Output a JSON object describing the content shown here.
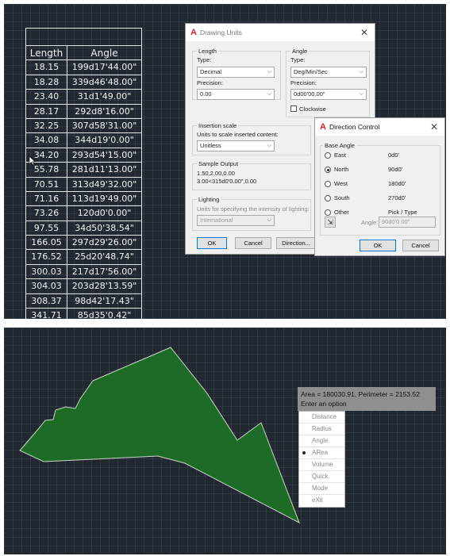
{
  "table": {
    "headers": [
      "Length",
      "Angle"
    ],
    "rows": [
      [
        "18.15",
        "199d17'44.00\""
      ],
      [
        "18.28",
        "339d46'48.00\""
      ],
      [
        "23.40",
        "31d1'49.00\""
      ],
      [
        "28.17",
        "292d8'16.00\""
      ],
      [
        "32.25",
        "307d58'31.00\""
      ],
      [
        "34.08",
        "344d19'0.00\""
      ],
      [
        "34.20",
        "293d54'15.00\""
      ],
      [
        "55.78",
        "281d11'13.00\""
      ],
      [
        "70.51",
        "313d49'32.00\""
      ],
      [
        "71.16",
        "113d19'49.00\""
      ],
      [
        "73.26",
        "120d0'0.00\""
      ],
      [
        "97.55",
        "34d50'38.54\""
      ],
      [
        "166.05",
        "297d29'26.00\""
      ],
      [
        "176.52",
        "25d20'48.74\""
      ],
      [
        "300.03",
        "217d17'56.00\""
      ],
      [
        "304.03",
        "203d28'13.59\""
      ],
      [
        "308.37",
        "98d42'17.43\""
      ],
      [
        "341.71",
        "85d35'0.42\""
      ]
    ]
  },
  "drawing_units": {
    "title": "Drawing Units",
    "length": {
      "group": "Length",
      "type_label": "Type:",
      "type_value": "Decimal",
      "precision_label": "Precision:",
      "precision_value": "0.00"
    },
    "angle": {
      "group": "Angle",
      "type_label": "Type:",
      "type_value": "Deg/Min/Sec",
      "precision_label": "Precision:",
      "precision_value": "0d00'00.00\"",
      "clockwise_label": "Clockwise"
    },
    "insertion": {
      "group": "Insertion scale",
      "label": "Units to scale inserted content:",
      "value": "Unitless"
    },
    "sample": {
      "group": "Sample Output",
      "line1": "1.50,2.00,0.00",
      "line2": "3.00<315d0'0.00\",0.00"
    },
    "lighting": {
      "group": "Lighting",
      "label": "Units for specifying the intensity of lighting:",
      "value": "International"
    },
    "ok": "OK",
    "cancel": "Cancel",
    "direction": "Direction..."
  },
  "direction_control": {
    "title": "Direction Control",
    "group": "Base Angle",
    "options": [
      {
        "label": "East",
        "value": "0d0'",
        "selected": false
      },
      {
        "label": "North",
        "value": "90d0'",
        "selected": true
      },
      {
        "label": "West",
        "value": "180d0'",
        "selected": false
      },
      {
        "label": "South",
        "value": "270d0'",
        "selected": false
      },
      {
        "label": "Other",
        "value": "Pick / Type",
        "selected": false
      }
    ],
    "angle_label": "Angle:",
    "angle_value": "90d0'0.00\"",
    "ok": "OK",
    "cancel": "Cancel"
  },
  "area_tooltip": {
    "line1": "Area = 180030.91, Perimeter = 2153.52",
    "line2": "Enter an option"
  },
  "option_menu": {
    "items": [
      "Distance",
      "Radius",
      "Angle",
      "ARea",
      "Volume",
      "Quick",
      "Mode",
      "eXit"
    ],
    "selected": "ARea"
  },
  "colors": {
    "canvas": "#212830",
    "polygon_fill": "#1e6b27",
    "polygon_stroke": "#c9d6c9",
    "autocad_red": "#d8232a"
  }
}
